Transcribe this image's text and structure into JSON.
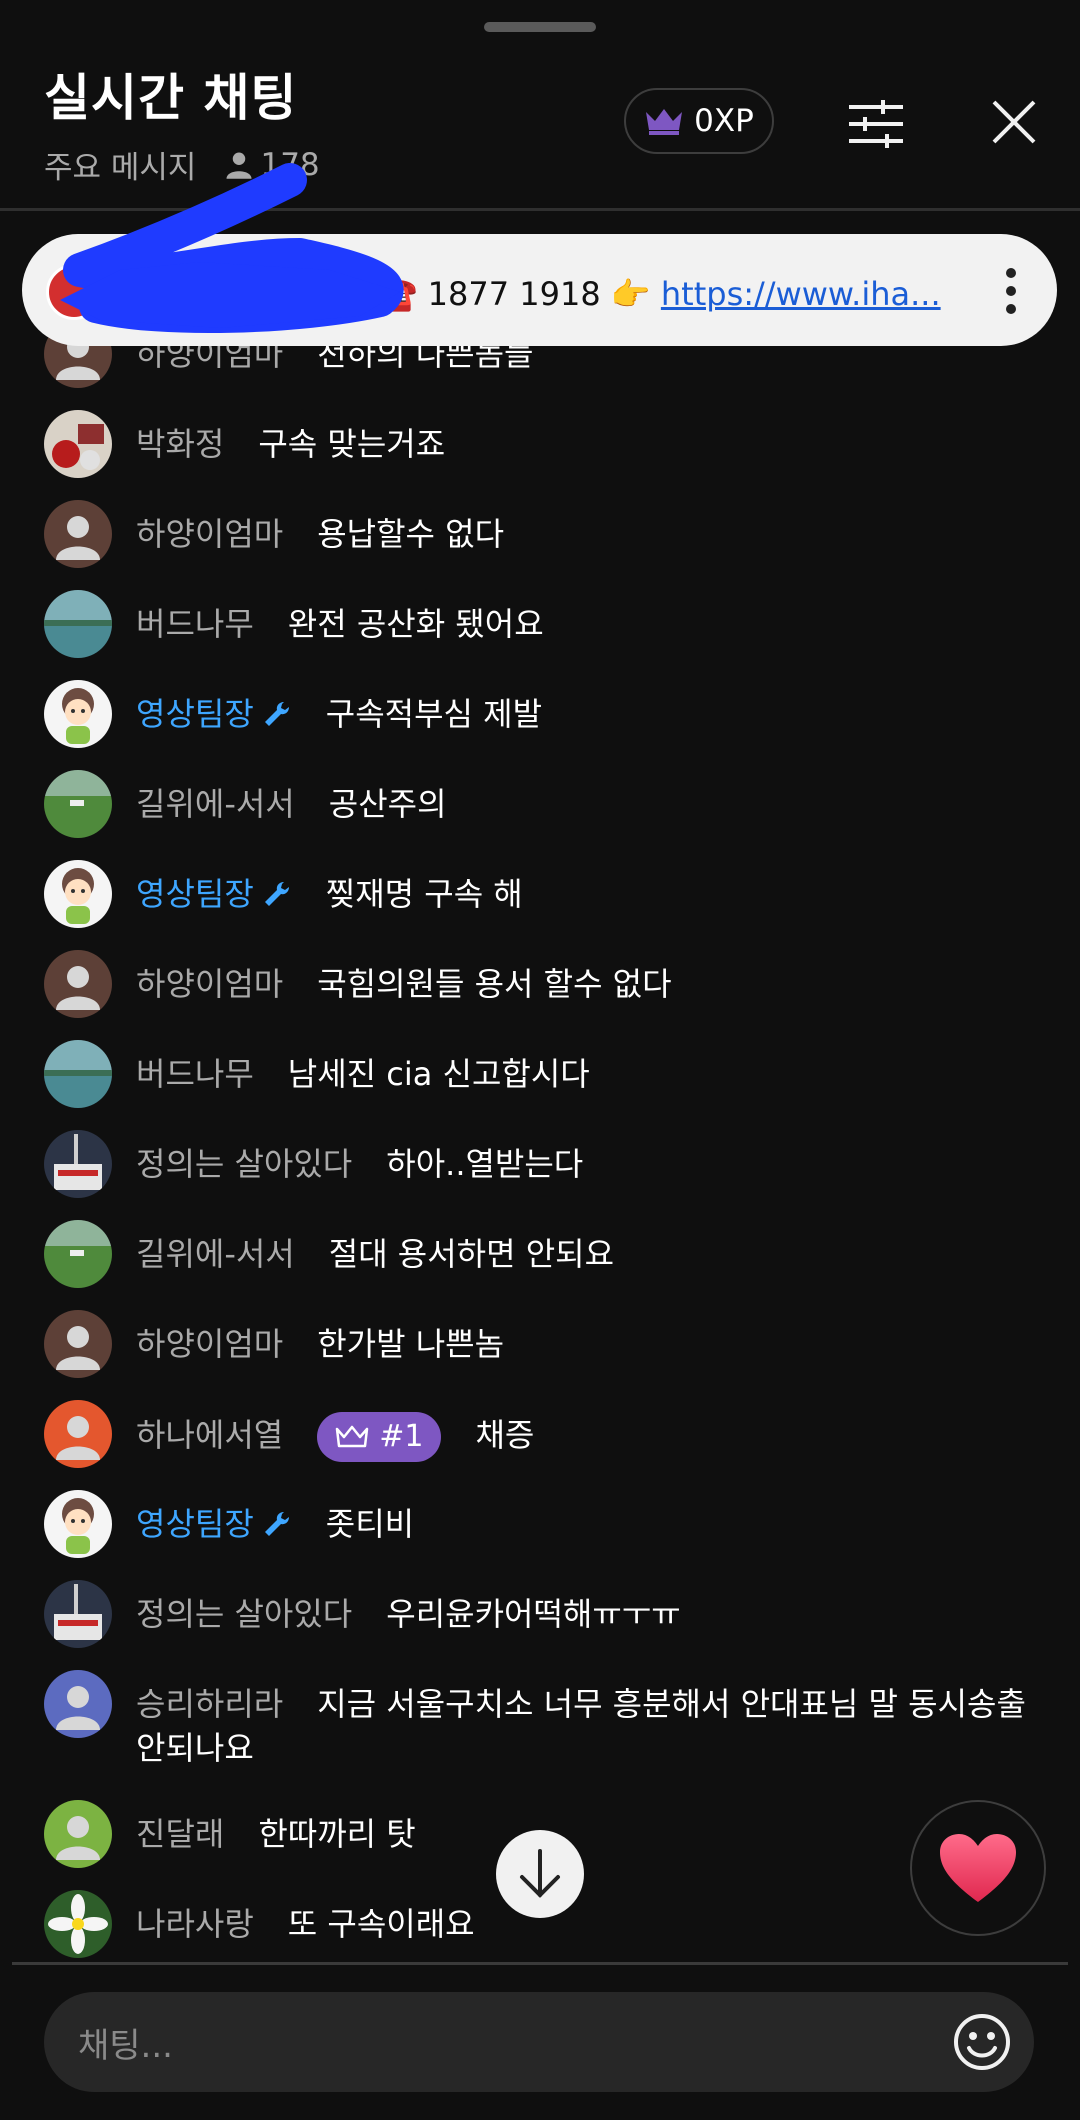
{
  "header": {
    "title": "실시간 채팅",
    "filter_label": "주요 메시지",
    "viewer_count": "178",
    "xp_label": "0XP"
  },
  "pinned": {
    "phone_text": "☎️ 1877 1918 👉",
    "link_text": "https://www.iha...",
    "partial_text": "공"
  },
  "messages": [
    {
      "author": "하양이엄마",
      "text": "천하의 나쁜놈들",
      "avatar": "default-brown",
      "mod": false
    },
    {
      "author": "박화정",
      "text": "구속 맞는거죠",
      "avatar": "photo-food",
      "mod": false
    },
    {
      "author": "하양이엄마",
      "text": "용납할수 없다",
      "avatar": "default-brown",
      "mod": false
    },
    {
      "author": "버드나무",
      "text": "완전 공산화 됐어요",
      "avatar": "photo-lake",
      "mod": false
    },
    {
      "author": "영상팀장",
      "text": "구속적부심 제발",
      "avatar": "cartoon-girl",
      "mod": true
    },
    {
      "author": "길위에-서서",
      "text": "공산주의",
      "avatar": "photo-field",
      "mod": false
    },
    {
      "author": "영상팀장",
      "text": "찢재명 구속 해",
      "avatar": "cartoon-girl",
      "mod": true
    },
    {
      "author": "하양이엄마",
      "text": "국힘의원들 용서 할수 없다",
      "avatar": "default-brown",
      "mod": false
    },
    {
      "author": "버드나무",
      "text": "남세진 cia 신고합시다",
      "avatar": "photo-lake",
      "mod": false
    },
    {
      "author": "정의는 살아있다",
      "text": "하아..열받는다",
      "avatar": "photo-protest",
      "mod": false
    },
    {
      "author": "길위에-서서",
      "text": "절대 용서하면 안되요",
      "avatar": "photo-field",
      "mod": false
    },
    {
      "author": "하양이엄마",
      "text": "한가발 나쁜놈",
      "avatar": "default-brown",
      "mod": false
    },
    {
      "author": "하나에서열",
      "text": "채증",
      "avatar": "default-orange",
      "mod": false,
      "badge": "#1"
    },
    {
      "author": "영상팀장",
      "text": "좃티비",
      "avatar": "cartoon-girl",
      "mod": true
    },
    {
      "author": "정의는 살아있다",
      "text": "우리윤카어떡해ㅠㅜㅠ",
      "avatar": "photo-protest",
      "mod": false
    },
    {
      "author": "승리하리라",
      "text": "지금 서울구치소 너무 흥분해서 안대표님 말 동시송출",
      "text2": "안되나요",
      "avatar": "default-indigo",
      "mod": false
    },
    {
      "author": "진달래",
      "text": "한따까리 탓",
      "avatar": "default-green",
      "mod": false
    },
    {
      "author": "나라사랑",
      "text": "또 구속이래요",
      "avatar": "photo-flower",
      "mod": false
    }
  ],
  "input": {
    "placeholder": "채팅..."
  },
  "colors": {
    "background": "#0f0f0f",
    "moderator": "#3ea6ff",
    "badge": "#7e57c2",
    "scribble": "#1f3bff"
  }
}
